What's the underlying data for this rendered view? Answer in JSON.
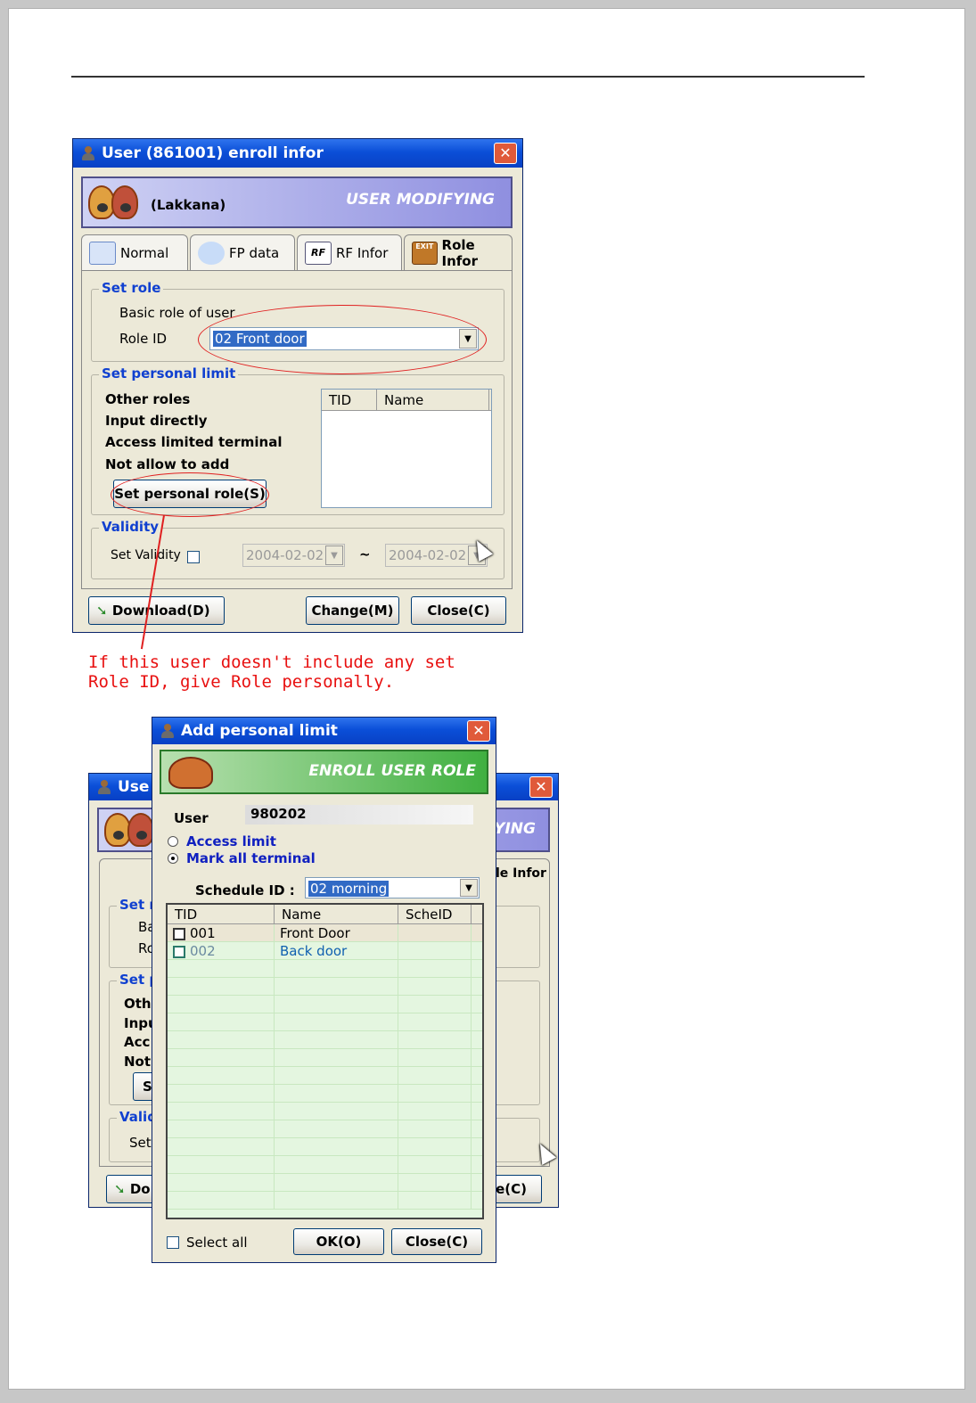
{
  "colors": {
    "title_blue": "#0b4fd8",
    "annotation_red": "#e02020",
    "legend_blue": "#1040d0",
    "grid_green": "#e4f6e0"
  },
  "enroll_window": {
    "title": "User (861001) enroll infor",
    "close_glyph": "✕",
    "user_name": "(Lakkana)",
    "banner_text": "USER MODIFYING",
    "tabs": [
      {
        "label": "Normal",
        "icon": "id-card-icon"
      },
      {
        "label": "FP data",
        "icon": "fingerprint-hand-icon"
      },
      {
        "label": "RF Infor",
        "icon": "rf-card-icon",
        "badge": "RF"
      },
      {
        "label": "Role Infor",
        "icon": "exit-door-icon",
        "badge": "EXIT"
      }
    ],
    "set_role": {
      "legend": "Set role",
      "basic_role_label": "Basic role of user",
      "role_id_label": "Role ID",
      "role_id_value": "02 Front door"
    },
    "personal_limit": {
      "legend": "Set personal limit",
      "items": [
        "Other roles",
        "Input directly",
        "Access limited terminal",
        "Not allow to add"
      ],
      "button_label": "Set personal role(S)",
      "columns": [
        "TID",
        "Name"
      ]
    },
    "validity": {
      "legend": "Validity",
      "set_validity_label": "Set Validity",
      "from_date": "2004-02-02",
      "separator": "~",
      "to_date": "2004-02-02"
    },
    "buttons": {
      "download": "Download(D)",
      "change": "Change(M)",
      "close": "Close(C)"
    }
  },
  "annotation": {
    "line1": "If this user doesn't include any set",
    "line2": "Role ID, give Role personally."
  },
  "back_window": {
    "title": "Use",
    "banner_fragment": "YING",
    "tab_fragment": "le Infor",
    "legend_set_role": "Set r",
    "label_ba": "Ba",
    "label_ro": "Ro",
    "legend_personal": "Set p",
    "items": [
      "Othe",
      "Inpu",
      "Acc",
      "Not"
    ],
    "button_fragment": "S",
    "legend_validity": "Valid",
    "set_fragment": "Set",
    "download_fragment": "Do",
    "close_fragment": "e(C)"
  },
  "personal_limit_dialog": {
    "title": "Add personal limit",
    "banner_text": "ENROLL USER ROLE",
    "user_label": "User",
    "user_value": "980202",
    "radio_access_limit": "Access limit",
    "radio_mark_all": "Mark all terminal",
    "schedule_label": "Schedule ID :",
    "schedule_value": "02 morning",
    "columns": [
      "TID",
      "Name",
      "ScheID"
    ],
    "rows": [
      {
        "tid": "001",
        "name": "Front Door",
        "sched": ""
      },
      {
        "tid": "002",
        "name": "Back door",
        "sched": ""
      }
    ],
    "select_all_label": "Select all",
    "ok_label": "OK(O)",
    "close_label": "Close(C)"
  }
}
